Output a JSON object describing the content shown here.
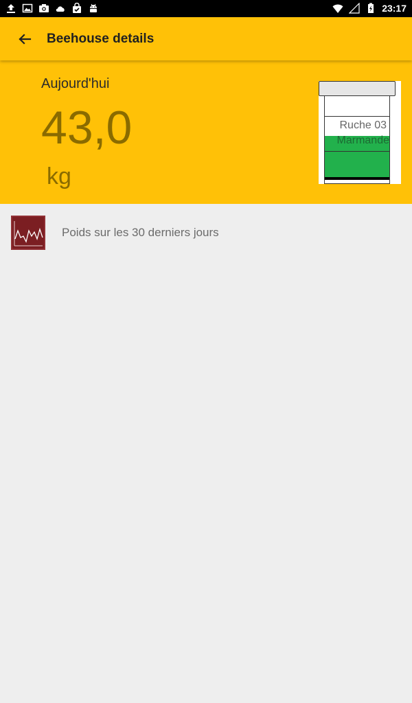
{
  "status_bar": {
    "time": "23:17",
    "left_icons": [
      "upload-icon",
      "image-icon",
      "camera-icon",
      "cloud-icon",
      "shopping-bag-icon",
      "android-icon"
    ],
    "right_icons": [
      "wifi-icon",
      "signal-icon",
      "battery-charging-icon"
    ]
  },
  "app_bar": {
    "title": "Beehouse details",
    "back_icon": "arrow-back-icon",
    "color": "#ffc107"
  },
  "header": {
    "today_label": "Aujourd'hui",
    "weight_value": "43,0",
    "weight_unit": "kg"
  },
  "hive": {
    "name": "Ruche 03",
    "location": "Marmande",
    "accent": "#22b14c"
  },
  "list": {
    "items": [
      {
        "label": "Poids sur les 30 derniers jours",
        "icon": "line-chart-icon",
        "icon_color": "#7b1e22"
      }
    ]
  }
}
